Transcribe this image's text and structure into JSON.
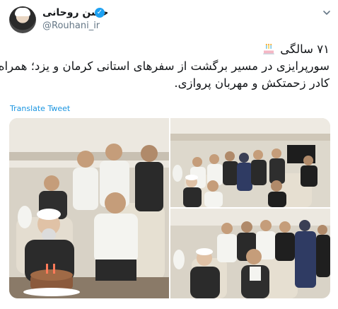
{
  "tweet": {
    "display_name": "حسن روحانی",
    "handle": "@Rouhani_ir",
    "text_lines": [
      "۷۱ سالگی",
      "سورپرایزی در مسیر برگشت از سفرهای استانی کرمان و یزد؛ همراه با",
      "کادر زحمتکش و مهربان پروازی."
    ],
    "translate_label": "Translate Tweet"
  },
  "icons": {
    "verified": "verified-badge-icon",
    "caret": "chevron-down-icon",
    "emoji": "birthday-cake-emoji"
  },
  "colors": {
    "verified_blue": "#1da1f2",
    "link_blue": "#1b95e0",
    "handle_gray": "#657786",
    "text": "#14171a"
  },
  "media": {
    "photo_count": 3,
    "photos": [
      "photo-cake-celebration",
      "photo-cabin-group",
      "photo-crew-group"
    ]
  }
}
